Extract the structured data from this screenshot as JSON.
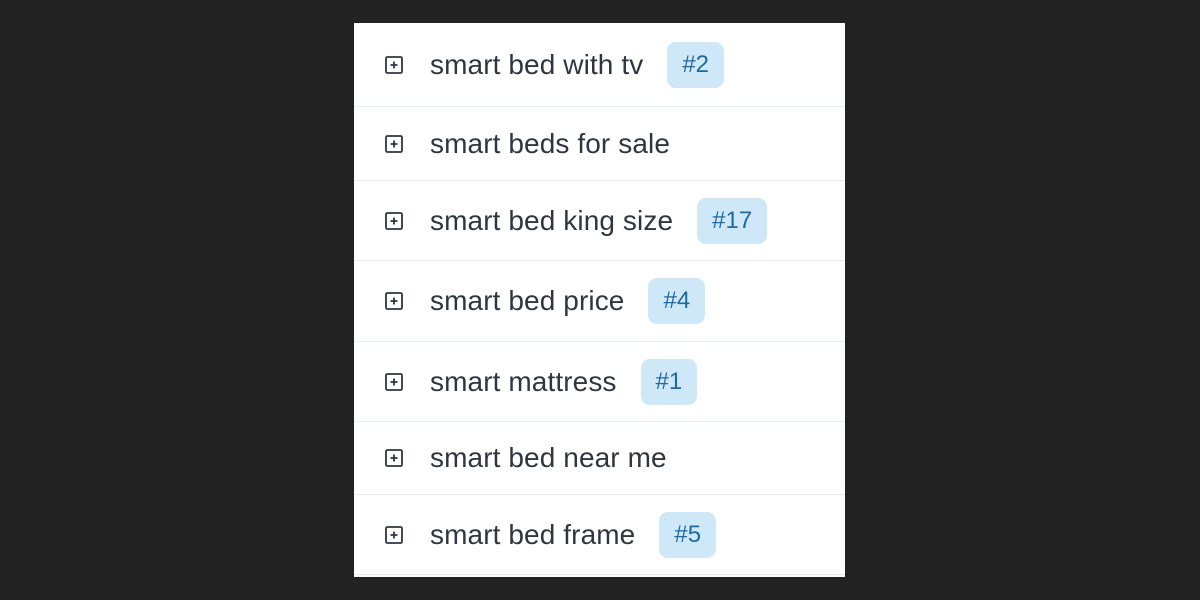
{
  "colors": {
    "background": "#222222",
    "panel": "#ffffff",
    "text": "#2f3640",
    "badge_bg": "#cfe8f8",
    "badge_text": "#1f6aa0",
    "divider": "#e6eef5"
  },
  "keywords": [
    {
      "icon": "plus-square-icon",
      "label": "smart bed with tv",
      "rank": "#2"
    },
    {
      "icon": "plus-square-icon",
      "label": "smart beds for sale",
      "rank": ""
    },
    {
      "icon": "plus-square-icon",
      "label": "smart bed king size",
      "rank": "#17"
    },
    {
      "icon": "plus-square-icon",
      "label": "smart bed price",
      "rank": "#4"
    },
    {
      "icon": "plus-square-icon",
      "label": "smart mattress",
      "rank": "#1"
    },
    {
      "icon": "plus-square-icon",
      "label": "smart bed near me",
      "rank": ""
    },
    {
      "icon": "plus-square-icon",
      "label": "smart bed frame",
      "rank": "#5"
    }
  ]
}
